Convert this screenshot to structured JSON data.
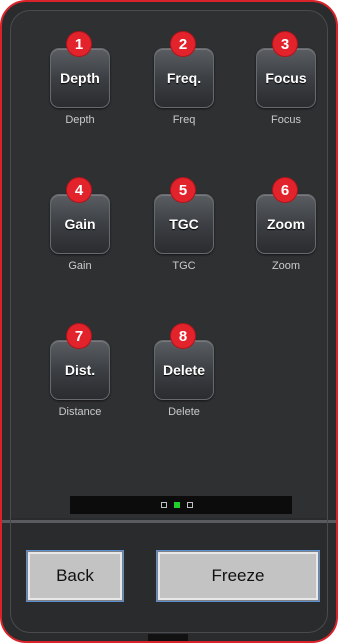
{
  "buttons": [
    {
      "badge": "1",
      "label": "Depth",
      "caption": "Depth"
    },
    {
      "badge": "2",
      "label": "Freq.",
      "caption": "Freq"
    },
    {
      "badge": "3",
      "label": "Focus",
      "caption": "Focus"
    },
    {
      "badge": "4",
      "label": "Gain",
      "caption": "Gain"
    },
    {
      "badge": "5",
      "label": "TGC",
      "caption": "TGC"
    },
    {
      "badge": "6",
      "label": "Zoom",
      "caption": "Zoom"
    },
    {
      "badge": "7",
      "label": "Dist.",
      "caption": "Distance"
    },
    {
      "badge": "8",
      "label": "Delete",
      "caption": "Delete"
    }
  ],
  "pager": {
    "pages": 3,
    "current_page": 2
  },
  "footer": {
    "back_label": "Back",
    "freeze_label": "Freeze"
  },
  "colors": {
    "accent": "#e3232c",
    "frame": "#d9232a",
    "active_page": "#1fd02b"
  }
}
